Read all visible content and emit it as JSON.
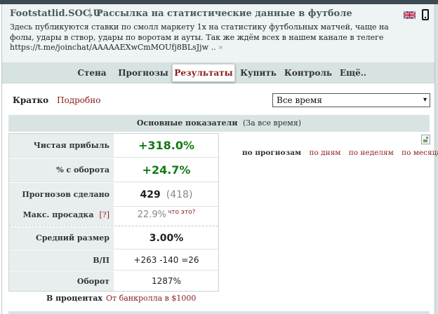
{
  "header": {
    "site_name": "Footstatlid.SOC.U",
    "separator": "|",
    "subtitle": "Рассылка на статистические данные в футболе",
    "description": "Здесь публикуются ставки по смолл маркету 1х на статистику футбольных матчей, чаще на фолы, удары в створ, удары по воротам и ауты. Так же ждём всех в нашем канале в телеге https://t.me/joinchat/AAAAAEXwCmMOUfj8BLsJjw ..",
    "more_glyph": "»",
    "icons": [
      "uk-flag-icon",
      "mobile-phone-icon"
    ]
  },
  "nav": {
    "items": [
      {
        "label": "Стена",
        "active": false
      },
      {
        "label": "Прогнозы",
        "active": false
      },
      {
        "label": "Результаты",
        "active": true
      },
      {
        "label": "Купить",
        "active": false
      },
      {
        "label": "Контроль",
        "active": false
      },
      {
        "label": "Ещё..",
        "active": false
      }
    ],
    "active_color": "#8b1a1a"
  },
  "view": {
    "brief": "Кратко",
    "detailed": "Подробно"
  },
  "period": {
    "selected": "Все время",
    "arrow": "▾"
  },
  "stats": {
    "title": "Основные показатели",
    "scope": "(За все время)",
    "net_profit": {
      "label": "Чистая прибыль",
      "value": "+318.0%"
    },
    "roi": {
      "label": "% с оборота",
      "value": "+24.7%"
    },
    "forecasts": {
      "label": "Прогнозов сделано",
      "value": "429",
      "secondary": "(418)"
    },
    "drawdown": {
      "label": "Макс. просадка",
      "help": "[?]",
      "value": "22.9%",
      "whatis": "что это?"
    },
    "avg_size": {
      "label": "Средний размер",
      "value": "3.00%"
    },
    "wl": {
      "label": "В/П",
      "value": "+263 -140 =26"
    },
    "turnover": {
      "label": "Оборот",
      "value": "1287%"
    },
    "accent_green": "#137a13"
  },
  "footer": {
    "percent_label": "В процентах",
    "bankroll_link": "От банкролла в $1000"
  },
  "chart_tabs": {
    "by_forecasts": "по прогнозам",
    "by_days": "по дням",
    "by_weeks": "по неделям",
    "by_months": "по месяцам"
  }
}
